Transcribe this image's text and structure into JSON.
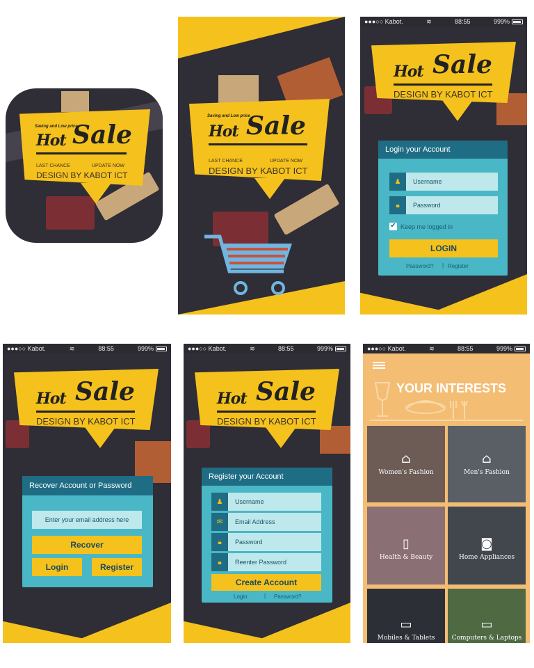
{
  "brand": {
    "tagline": "Saving and Low price",
    "hot": "Hot",
    "sale": "Sale",
    "last_chance": "LAST CHANCE",
    "update_now": "UPDATE NOW",
    "design": "DESIGN BY KABOT ICT"
  },
  "status": {
    "carrier": "●●●○○ Kabot.",
    "wifi": "≋",
    "time": "88:55",
    "battery": "999%"
  },
  "login": {
    "title": "Login your Account",
    "username": "Username",
    "password": "Password",
    "keep": "Keep me logged in",
    "button": "LOGIN",
    "forgot": "Password?",
    "separator": "|",
    "register": "Register"
  },
  "recover": {
    "title": "Recover Account or Password",
    "email_placeholder": "Enter your email address here",
    "recover_button": "Recover",
    "login_button": "Login",
    "register_button": "Register"
  },
  "register": {
    "title": "Register your Account",
    "username": "Username",
    "email": "Email Address",
    "password": "Password",
    "reenter": "Reenter Password",
    "button": "Create Account",
    "login": "Login",
    "separator": "|",
    "forgot": "Password?"
  },
  "interests": {
    "title": "YOUR INTERESTS",
    "categories": [
      {
        "label": "Women's Fashion",
        "color": "#6d5b55"
      },
      {
        "label": "Men's Fashion",
        "color": "#5a5f66"
      },
      {
        "label": "Health & Beauty",
        "color": "#8a6f74"
      },
      {
        "label": "Home Appliances",
        "color": "#41474d"
      },
      {
        "label": "Mobiles & Tablets",
        "color": "#2c2f35"
      },
      {
        "label": "Computers & Laptops",
        "color": "#4f6a43"
      }
    ]
  },
  "colors": {
    "accent": "#f5c11d",
    "dark": "#2f2d36",
    "teal": "#49b7c5",
    "navy": "#1f6d85",
    "peach": "#f4bd74"
  }
}
